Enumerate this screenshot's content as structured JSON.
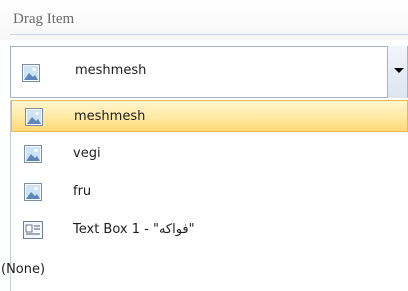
{
  "header": {
    "title": "Drag Item"
  },
  "combo": {
    "selected_label": "meshmesh"
  },
  "list": {
    "items": [
      {
        "label": "meshmesh",
        "icon": "picture-icon",
        "selected": true
      },
      {
        "label": "vegi",
        "icon": "picture-icon",
        "selected": false
      },
      {
        "label": "fru",
        "icon": "picture-icon",
        "selected": false
      },
      {
        "label": "Text Box 1 - \"فواكه\"",
        "icon": "textbox-icon",
        "selected": false
      },
      {
        "label": "(None)",
        "icon": "",
        "selected": false
      }
    ]
  },
  "colors": {
    "selection_fill": "#ffe9a3",
    "selection_border": "#e8b94c",
    "border": "#a4b3c5"
  }
}
